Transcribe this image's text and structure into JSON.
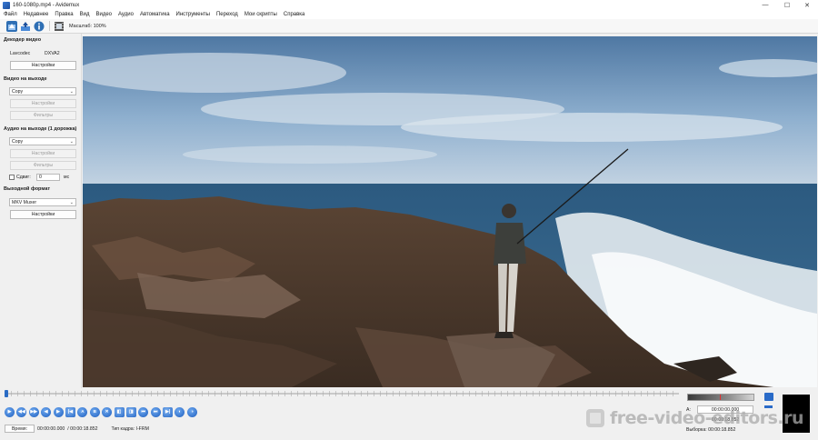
{
  "window": {
    "title": "160-1080p.mp4 - Avidemux",
    "minimize_glyph": "—",
    "maximize_glyph": "☐",
    "close_glyph": "✕"
  },
  "menu": [
    "Файл",
    "Недавнее",
    "Правка",
    "Вид",
    "Видео",
    "Аудио",
    "Автоматика",
    "Инструменты",
    "Переход",
    "Мои скрипты",
    "Справка"
  ],
  "toolbar": {
    "icons": [
      "open-video-icon",
      "save-video-icon",
      "info-icon",
      "calculator-icon"
    ],
    "zoom_label": "Масштаб: 100%"
  },
  "left_panel": {
    "decoder": {
      "title": "Декодер видео",
      "decoder_key": "Lavcodec",
      "decoder_value": "DXVA2",
      "settings_button": "Настройки"
    },
    "video_output": {
      "title": "Видео на выходе",
      "codec": "Copy",
      "settings_button": "Настройки",
      "filters_button": "Фильтры"
    },
    "audio_output": {
      "title": "Аудио на выходе (1 дорожка)",
      "codec": "Copy",
      "settings_button": "Настройки",
      "filters_button": "Фильтры",
      "shift_label": "Сдвиг:",
      "shift_value": "0",
      "shift_unit": "мс"
    },
    "output_format": {
      "title": "Выходной формат",
      "muxer": "MKV Muxer",
      "settings_button": "Настройки"
    }
  },
  "playback": {
    "position": 0.0,
    "buttons": [
      "play",
      "rewind",
      "fast-forward",
      "prev-frame",
      "next-frame",
      "prev-intra",
      "next-intra",
      "set-marker-a",
      "set-marker-b",
      "reset-markers",
      "goto-marker-a",
      "goto-marker-b",
      "goto-start",
      "goto-end",
      "prev-black",
      "next-black"
    ],
    "marker_a_label": "A",
    "marker_b_label": "B"
  },
  "status": {
    "time_button": "Время:",
    "current_time": "00:00:00.000",
    "total_time": "/ 00:00:18.852",
    "frame_type": "Тип кадра: I-FRM"
  },
  "selection": {
    "a_label": "A:",
    "a_time": "00:00:00.000",
    "b_label": "B:",
    "b_time": "00:00:18.852",
    "selection_text": "Выборка: 00:00:18.852"
  },
  "watermark": {
    "text": "free-video-editors.ru"
  },
  "colors": {
    "accent": "#2a6bc8",
    "panel_bg": "#f0f0f0",
    "titlebar_bg": "#ffffff"
  }
}
